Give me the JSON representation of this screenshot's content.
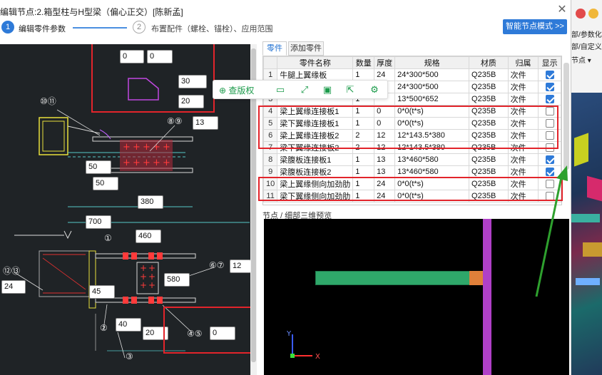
{
  "window": {
    "title": "编辑节点:2.箱型柱与H型梁（偏心正交）[陈新孟]",
    "close_glyph": "✕"
  },
  "steps": {
    "step1_num": "1",
    "step1_label": "编辑零件参数",
    "step2_num": "2",
    "step2_label": "布置配件（螺栓、锚栓）、应用范围",
    "smart_mode_button": "智能节点模式 >>"
  },
  "drawing": {
    "inputs": [
      "0",
      "0",
      "30",
      "20",
      "13",
      "50",
      "50",
      "380",
      "700",
      "460",
      "12",
      "24",
      "45",
      "580",
      "40",
      "20",
      "0"
    ],
    "callouts": [
      "⑩⑪",
      "⑧⑨",
      "①",
      "⑫⑬",
      "⑥⑦",
      "②",
      "④⑤",
      "③"
    ]
  },
  "floating_toolbar": {
    "label": "查版权",
    "icons": [
      "search-icon",
      "copy-icon",
      "fullscreen-icon",
      "save-icon",
      "share-icon",
      "settings-icon"
    ]
  },
  "parts_panel": {
    "tabs": [
      "零件",
      "添加零件"
    ],
    "columns": [
      "零件名称",
      "数量",
      "厚度",
      "规格",
      "材质",
      "归属",
      "显示"
    ],
    "rows": [
      {
        "idx": "1",
        "name": "牛腿上翼缘板",
        "qty": "1",
        "thk": "24",
        "spec": "24*300*500",
        "mat": "Q235B",
        "owner": "次件",
        "show": true
      },
      {
        "idx": "2",
        "name": "",
        "qty": "1",
        "thk": "24",
        "spec": "24*300*500",
        "mat": "Q235B",
        "owner": "次件",
        "show": true
      },
      {
        "idx": "3",
        "name": "",
        "qty": "1",
        "thk": "",
        "spec": "13*500*652",
        "mat": "Q235B",
        "owner": "次件",
        "show": true
      },
      {
        "idx": "4",
        "name": "梁上翼缘连接板1",
        "qty": "1",
        "thk": "0",
        "spec": "0*0(t*s)",
        "mat": "Q235B",
        "owner": "次件",
        "show": false
      },
      {
        "idx": "5",
        "name": "梁下翼缘连接板1",
        "qty": "1",
        "thk": "0",
        "spec": "0*0(t*s)",
        "mat": "Q235B",
        "owner": "次件",
        "show": false
      },
      {
        "idx": "6",
        "name": "梁上翼缘连接板2",
        "qty": "2",
        "thk": "12",
        "spec": "12*143.5*380",
        "mat": "Q235B",
        "owner": "次件",
        "show": false
      },
      {
        "idx": "7",
        "name": "梁下翼缘连接板2",
        "qty": "2",
        "thk": "12",
        "spec": "12*143.5*380",
        "mat": "Q235B",
        "owner": "次件",
        "show": false
      },
      {
        "idx": "8",
        "name": "梁腹板连接板1",
        "qty": "1",
        "thk": "13",
        "spec": "13*460*580",
        "mat": "Q235B",
        "owner": "次件",
        "show": true
      },
      {
        "idx": "9",
        "name": "梁腹板连接板2",
        "qty": "1",
        "thk": "13",
        "spec": "13*460*580",
        "mat": "Q235B",
        "owner": "次件",
        "show": true
      },
      {
        "idx": "10",
        "name": "梁上翼缘侧向加劲肋",
        "qty": "1",
        "thk": "24",
        "spec": "0*0(t*s)",
        "mat": "Q235B",
        "owner": "次件",
        "show": false
      },
      {
        "idx": "11",
        "name": "梁下翼缘侧向加劲肋",
        "qty": "1",
        "thk": "24",
        "spec": "0*0(t*s)",
        "mat": "Q235B",
        "owner": "次件",
        "show": false
      }
    ]
  },
  "preview": {
    "label": "节点 / 细部三维预览",
    "axis_x": "X",
    "axis_y": "Y"
  },
  "background_app": {
    "texts": [
      "部/参数化",
      "部/自定义",
      "节点 ▾"
    ]
  },
  "colors": {
    "accent": "#2e7ad8",
    "highlight_red": "#e2242b",
    "annotation_green": "#1c9b4b",
    "canvas_bg": "#1f2326"
  }
}
